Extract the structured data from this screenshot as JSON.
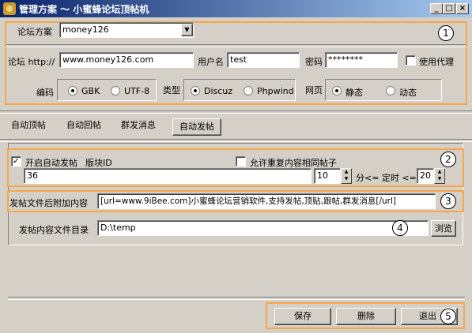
{
  "window": {
    "title": "管理方案 ～ 小蜜蜂论坛顶帖机",
    "min": "_",
    "max": "□",
    "close": "×"
  },
  "callouts": [
    "1",
    "2",
    "3",
    "4",
    "5"
  ],
  "forum": {
    "scheme_label": "论坛方案",
    "scheme_value": "money126",
    "url_label": "论坛 http://",
    "url_value": "www.money126.com",
    "user_label": "用户名",
    "user_value": "test",
    "pass_label": "密码",
    "pass_value": "********",
    "proxy_label": "使用代理",
    "encoding_label": "编码",
    "encoding_options": [
      "GBK",
      "UTF-8"
    ],
    "type_label": "类型",
    "type_options": [
      "Discuz",
      "Phpwind"
    ],
    "page_label": "网页",
    "page_options": [
      "静态",
      "动态"
    ]
  },
  "tabs": [
    "自动顶帖",
    "自动回帖",
    "群发消息",
    "自动发帖"
  ],
  "auto_post": {
    "enable_label": "开启自动发帖",
    "board_label": "版块ID",
    "board_value": "36",
    "allow_dup_label": "允许重复内容相同帖子",
    "min_value": "10",
    "timer_label": "分<= 定时 <=",
    "max_value": "20",
    "append_label": "发帖文件后附加内容",
    "append_value": "[url=www.9iBee.com]小蜜蜂论坛营销软件,支持发帖,顶贴,跟帖,群发消息[/url]",
    "dir_label": "发帖内容文件目录",
    "dir_value": "D:\\temp",
    "browse_label": "浏览"
  },
  "buttons": {
    "save": "保存",
    "delete": "删除",
    "exit": "退出"
  }
}
